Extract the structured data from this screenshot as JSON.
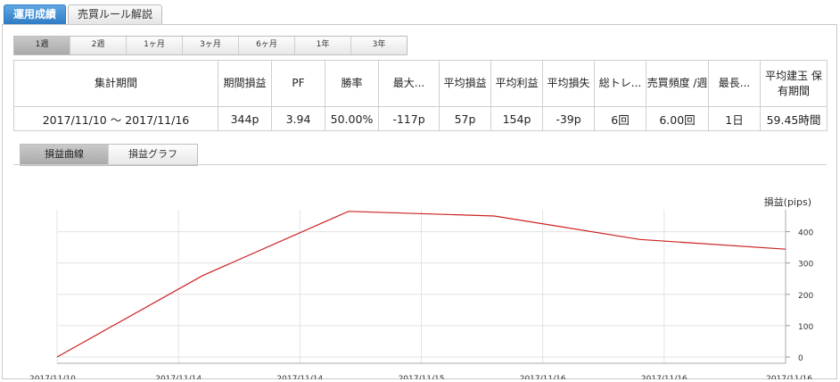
{
  "main_tabs": [
    {
      "label": "運用成績",
      "active": true
    },
    {
      "label": "売買ルール解説",
      "active": false
    }
  ],
  "period_tabs": [
    {
      "label": "1週",
      "active": true
    },
    {
      "label": "2週",
      "active": false
    },
    {
      "label": "1ヶ月",
      "active": false
    },
    {
      "label": "3ヶ月",
      "active": false
    },
    {
      "label": "6ヶ月",
      "active": false
    },
    {
      "label": "1年",
      "active": false
    },
    {
      "label": "3年",
      "active": false
    }
  ],
  "stats": {
    "headers": [
      "集計期間",
      "期間損益",
      "PF",
      "勝率",
      "最大...",
      "平均損益",
      "平均利益",
      "平均損失",
      "総トレ...",
      "売買頻度\n/週",
      "最長...",
      "平均建玉\n保有期間"
    ],
    "values": [
      "2017/11/10 〜 2017/11/16",
      "344p",
      "3.94",
      "50.00%",
      "-117p",
      "57p",
      "154p",
      "-39p",
      "6回",
      "6.00回",
      "1日",
      "59.45時間"
    ]
  },
  "chart_tabs": [
    {
      "label": "損益曲線",
      "active": true
    },
    {
      "label": "損益グラフ",
      "active": false
    }
  ],
  "chart_data": {
    "type": "line",
    "ylabel": "損益(pips)",
    "y_ticks": [
      0,
      100,
      200,
      300,
      400
    ],
    "ylim": [
      -20,
      470
    ],
    "grid": true,
    "x": [
      "2017/11/10",
      "2017/11/14",
      "2017/11/14",
      "2017/11/15",
      "2017/11/16",
      "2017/11/16",
      "2017/11/16"
    ],
    "series": [
      {
        "values": [
          0,
          260,
          465,
          450,
          375,
          344
        ],
        "color": "#cc2222"
      }
    ]
  }
}
